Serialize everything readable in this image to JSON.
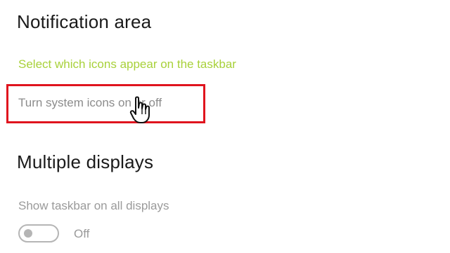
{
  "notification_area": {
    "title": "Notification area",
    "select_icons_link": "Select which icons appear on the taskbar",
    "system_icons_link": "Turn system icons on or off"
  },
  "multiple_displays": {
    "title": "Multiple displays",
    "show_taskbar_label": "Show taskbar on all displays",
    "toggle_state": "Off"
  },
  "colors": {
    "link_accent": "#a8d13a",
    "highlight_border": "#e0141e",
    "muted_text": "#8c8c8c"
  },
  "icons": {
    "cursor": "hand-pointer-icon"
  }
}
